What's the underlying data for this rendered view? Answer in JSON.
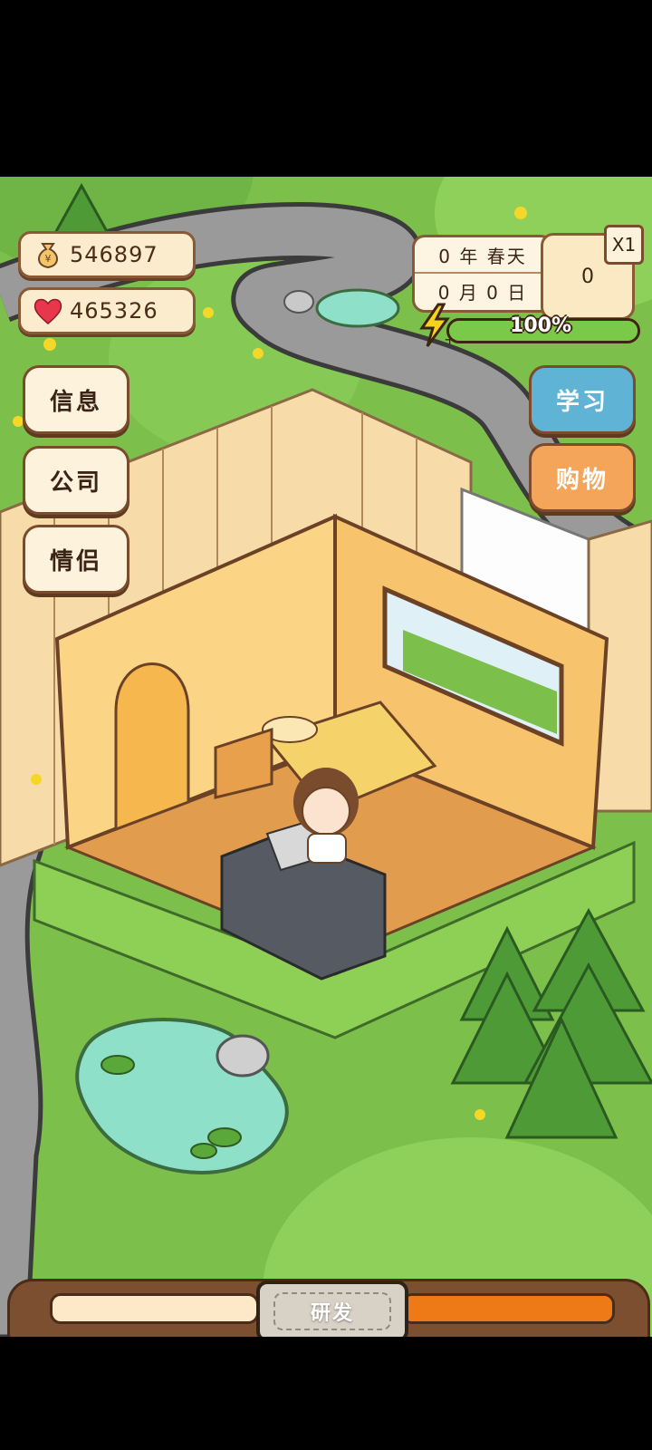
{
  "resources": {
    "money": "546897",
    "affection": "465326"
  },
  "calendar": {
    "year_season": "0 年 春天",
    "month_day": "0 月 0 日"
  },
  "portrait_label": "0",
  "speed_label": "X1",
  "energy": {
    "percent_label": "100%",
    "percent": 100
  },
  "menu": {
    "left": [
      "信息",
      "公司",
      "情侣"
    ],
    "study": "学习",
    "shop": "购物"
  },
  "colors": {
    "study_button": "#5fb3d4",
    "shop_button": "#f5a55a",
    "grass": "#7cbf4a",
    "road": "#9a9a9a",
    "progress_orange": "#ee7a17"
  },
  "bottom": {
    "research_label": "研发",
    "left_progress": 0,
    "right_progress": 100
  },
  "icons": [
    "money-bag-icon",
    "heart-icon",
    "lightning-bolt-icon"
  ]
}
